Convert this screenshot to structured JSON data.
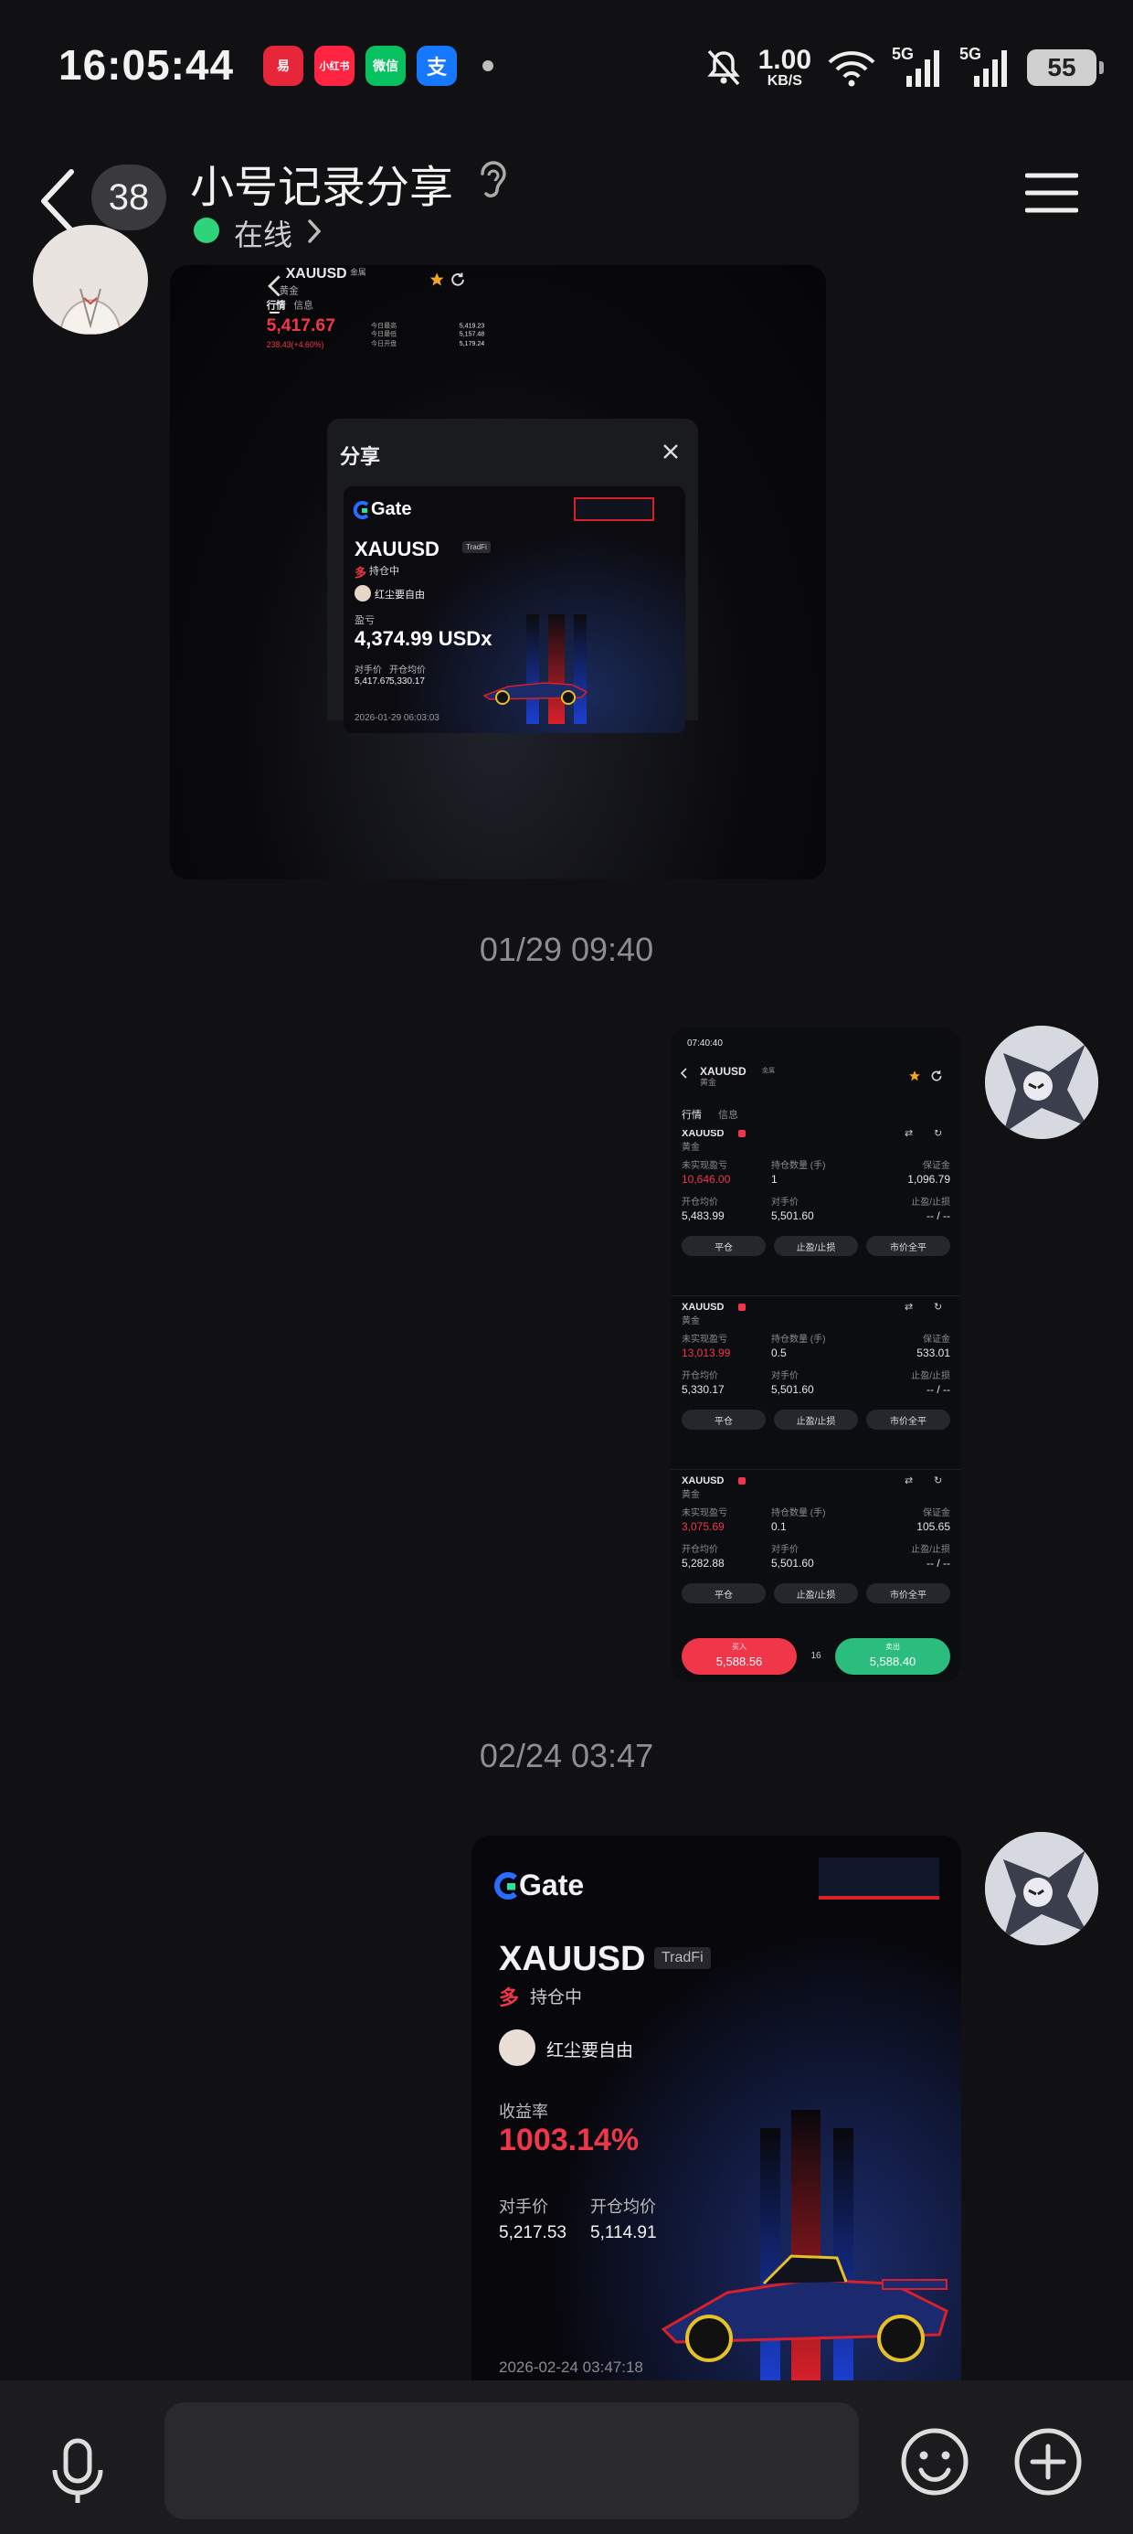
{
  "status_bar": {
    "time": "16:05:44",
    "apps": [
      "易",
      "小红书",
      "微信",
      "支"
    ],
    "net_speed_value": "1.00",
    "net_speed_unit": "KB/S",
    "signal_1": "5G",
    "signal_2": "5G",
    "battery": "55"
  },
  "header": {
    "unread_count": "38",
    "title": "小号记录分享",
    "online_status": "在线"
  },
  "messages": {
    "shot1": {
      "symbol": "XAUUSD",
      "symbol_badge": "金属",
      "sub": "黄金",
      "tab_quote": "行情",
      "tab_info": "信息",
      "price": "5,417.67",
      "change": "238.43(+4.60%)",
      "stats_labels": [
        "今日最高",
        "今日最低",
        "今日开盘"
      ],
      "stats_values": [
        "5,419.23",
        "5,157.48",
        "5,179.24"
      ],
      "modal_title": "分享",
      "brand": "Gate",
      "card_symbol": "XAUUSD",
      "card_badge": "TradFi",
      "side": "多",
      "status": "持仓中",
      "user": "红尘要自由",
      "pnl_label": "盈亏",
      "pnl_value": "4,374.99 USDx",
      "counter_label": "对手价",
      "open_label": "开仓均价",
      "counter_value": "5,417.67",
      "open_value": "5,330.17",
      "datetime": "2026-01-29 06:03:03"
    },
    "time_1": "01/29 09:40",
    "shot2": {
      "time": "07:40:40",
      "symbol": "XAUUSD",
      "symbol_badge": "金属",
      "sub": "黄金",
      "tab_quote": "行情",
      "tab_info": "信息",
      "labels": {
        "unrealized": "未实现盈亏",
        "qty": "持仓数量 (手)",
        "margin": "保证金",
        "open_avg": "开仓均价",
        "counter": "对手价",
        "tp_sl": "止盈/止损"
      },
      "positions": [
        {
          "symbol": "XAUUSD",
          "sub": "黄金",
          "pnl": "10,646.00",
          "qty": "1",
          "margin": "1,096.79",
          "open": "5,483.99",
          "counter": "5,501.60",
          "tpsl": "-- / --"
        },
        {
          "symbol": "XAUUSD",
          "sub": "黄金",
          "pnl": "13,013.99",
          "qty": "0.5",
          "margin": "533.01",
          "open": "5,330.17",
          "counter": "5,501.60",
          "tpsl": "-- / --"
        },
        {
          "symbol": "XAUUSD",
          "sub": "黄金",
          "pnl": "3,075.69",
          "qty": "0.1",
          "margin": "105.65",
          "open": "5,282.88",
          "counter": "5,501.60",
          "tpsl": "-- / --"
        }
      ],
      "buttons": [
        "平仓",
        "止盈/止损",
        "市价全平"
      ],
      "buy_label": "买入",
      "buy_price": "5,588.56",
      "spread": "16",
      "sell_label": "卖出",
      "sell_price": "5,588.40"
    },
    "time_2": "02/24 03:47",
    "shot3": {
      "brand": "Gate",
      "symbol": "XAUUSD",
      "badge": "TradFi",
      "side": "多",
      "status": "持仓中",
      "user": "红尘要自由",
      "roi_label": "收益率",
      "roi_value": "1003.14%",
      "counter_label": "对手价",
      "open_label": "开仓均价",
      "counter_value": "5,217.53",
      "open_value": "5,114.91",
      "datetime": "2026-02-24 03:47:18"
    }
  },
  "colors": {
    "accent_red": "#f0374a",
    "online_green": "#2fd37a",
    "buy_red": "#f0374a",
    "sell_green": "#2bbd7e"
  }
}
